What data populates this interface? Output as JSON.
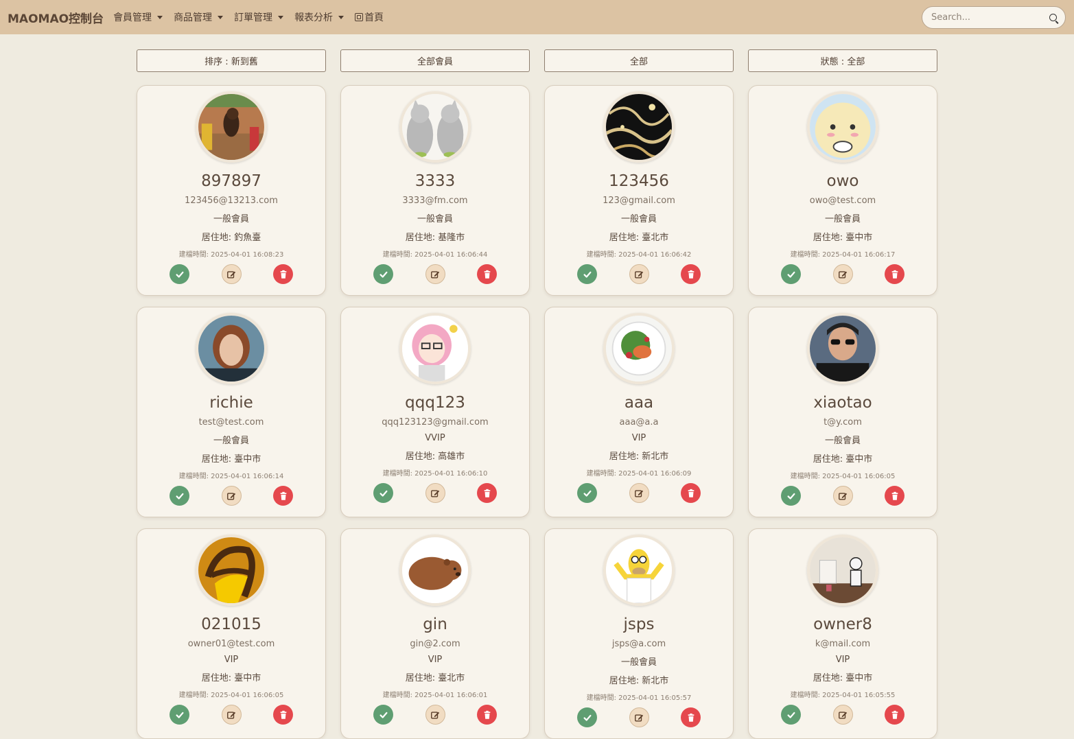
{
  "nav": {
    "brand": "MAOMAO控制台",
    "menu": [
      {
        "label": "會員管理"
      },
      {
        "label": "商品管理"
      },
      {
        "label": "訂單管理"
      },
      {
        "label": "報表分析"
      }
    ],
    "home_label": "首頁",
    "search_placeholder": "Search..."
  },
  "filters": {
    "sort": "排序 : 新到舊",
    "members": "全部會員",
    "level": "全部",
    "status": "狀態 : 全部"
  },
  "colors": {
    "navbar": "#dcc3a3",
    "background": "#efebe0",
    "approve": "#5f9e72",
    "edit": "#f1dcc2",
    "delete": "#e5484d"
  },
  "members": [
    {
      "name": "897897",
      "email": "123456@13213.com",
      "level": "一般會員",
      "city": "居住地: 釣魚臺",
      "created": "建檔時間: 2025-04-01 16:08:23",
      "avatar": "dog-photo"
    },
    {
      "name": "3333",
      "email": "3333@fm.com",
      "level": "一般會員",
      "city": "居住地: 基隆市",
      "created": "建檔時間: 2025-04-01 16:06:44",
      "avatar": "twin-cats"
    },
    {
      "name": "123456",
      "email": "123@gmail.com",
      "level": "一般會員",
      "city": "居住地: 臺北市",
      "created": "建檔時間: 2025-04-01 16:06:42",
      "avatar": "starry-pattern"
    },
    {
      "name": "owo",
      "email": "owo@test.com",
      "level": "一般會員",
      "city": "居住地: 臺中市",
      "created": "建檔時間: 2025-04-01 16:06:17",
      "avatar": "cartoon-face"
    },
    {
      "name": "richie",
      "email": "test@test.com",
      "level": "一般會員",
      "city": "居住地: 臺中市",
      "created": "建檔時間: 2025-04-01 16:06:14",
      "avatar": "woman-portrait"
    },
    {
      "name": "qqq123",
      "email": "qqq123123@gmail.com",
      "level": "VVIP",
      "city": "居住地: 高雄市",
      "created": "建檔時間: 2025-04-01 16:06:10",
      "avatar": "anime-girl"
    },
    {
      "name": "aaa",
      "email": "aaa@a.a",
      "level": "VIP",
      "city": "居住地: 新北市",
      "created": "建檔時間: 2025-04-01 16:06:09",
      "avatar": "salad-dish"
    },
    {
      "name": "xiaotao",
      "email": "t@y.com",
      "level": "一般會員",
      "city": "居住地: 臺中市",
      "created": "建檔時間: 2025-04-01 16:06:05",
      "avatar": "man-sunglasses"
    },
    {
      "name": "021015",
      "email": "owner01@test.com",
      "level": "VIP",
      "city": "居住地: 臺中市",
      "created": "建檔時間: 2025-04-01 16:06:05",
      "avatar": "brown-logo"
    },
    {
      "name": "gin",
      "email": "gin@2.com",
      "level": "VIP",
      "city": "居住地: 臺北市",
      "created": "建檔時間: 2025-04-01 16:06:01",
      "avatar": "brown-bear"
    },
    {
      "name": "jsps",
      "email": "jsps@a.com",
      "level": "一般會員",
      "city": "居住地: 新北市",
      "created": "建檔時間: 2025-04-01 16:05:57",
      "avatar": "cartoon-man"
    },
    {
      "name": "owner8",
      "email": "k@mail.com",
      "level": "VIP",
      "city": "居住地: 臺中市",
      "created": "建檔時間: 2025-04-01 16:05:55",
      "avatar": "toy-figure"
    }
  ]
}
